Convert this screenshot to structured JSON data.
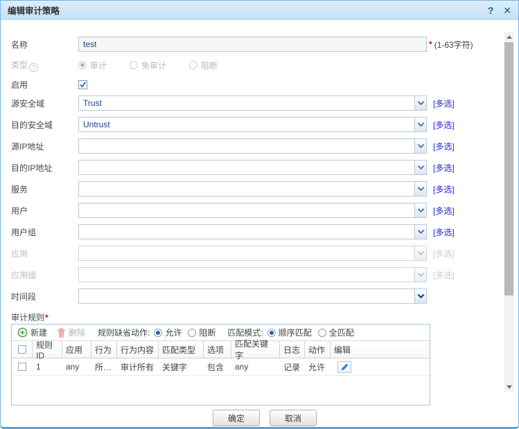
{
  "dialog": {
    "title": "编辑审计策略",
    "help_icon": "?",
    "close_icon": "✕"
  },
  "name_field": {
    "label": "名称",
    "value": "test",
    "required_mark": "*",
    "hint": "(1-63字符)"
  },
  "type_field": {
    "label": "类型",
    "help_icon": "?",
    "options": [
      "审计",
      "免审计",
      "阻断"
    ],
    "selected": "审计"
  },
  "enable_field": {
    "label": "启用",
    "checked": true
  },
  "combos": [
    {
      "label": "源安全域",
      "value": "Trust",
      "multi_label": "[多选]"
    },
    {
      "label": "目的安全域",
      "value": "Untrust",
      "multi_label": "[多选]"
    },
    {
      "label": "源IP地址",
      "value": "",
      "multi_label": "[多选]"
    },
    {
      "label": "目的IP地址",
      "value": "",
      "multi_label": "[多选]"
    },
    {
      "label": "服务",
      "value": "",
      "multi_label": "[多选]"
    },
    {
      "label": "用户",
      "value": "",
      "multi_label": "[多选]"
    },
    {
      "label": "用户组",
      "value": "",
      "multi_label": "[多选]"
    },
    {
      "label": "应用",
      "value": "",
      "multi_label": "[多选]",
      "disabled": true
    },
    {
      "label": "应用组",
      "value": "",
      "multi_label": "[多选]",
      "disabled": true
    },
    {
      "label": "时间段",
      "value": ""
    }
  ],
  "rules": {
    "label": "审计规则",
    "required_mark": "*",
    "toolbar": {
      "new_label": "新建",
      "delete_label": "删除",
      "default_action_label": "规则缺省动作:",
      "default_action_options": [
        "允许",
        "阻断"
      ],
      "default_action_selected": "允许",
      "match_mode_label": "匹配模式:",
      "match_mode_options": [
        "顺序匹配",
        "全匹配"
      ],
      "match_mode_selected": "顺序匹配"
    },
    "table": {
      "columns": [
        "规则ID",
        "应用",
        "行为",
        "行为内容",
        "匹配类型",
        "选项",
        "匹配关键字",
        "日志",
        "动作",
        "编辑"
      ],
      "rows": [
        {
          "cells": [
            "1",
            "any",
            "所有...",
            "审计所有",
            "关键字",
            "包含",
            "any",
            "记录",
            "允许"
          ]
        }
      ]
    }
  },
  "footer": {
    "ok_label": "确定",
    "cancel_label": "取消"
  },
  "colors": {
    "title_bar": "#cde4f5",
    "value_text": "#15428b",
    "link_blue": "#2323cc",
    "required_red": "#e00000",
    "panel_border": "#a6c5e0",
    "new_icon_green": "#44a044",
    "trash_icon_red": "#e59a9a",
    "edit_icon_blue": "#3787c8",
    "dialog_border": "#5e9fd0"
  }
}
